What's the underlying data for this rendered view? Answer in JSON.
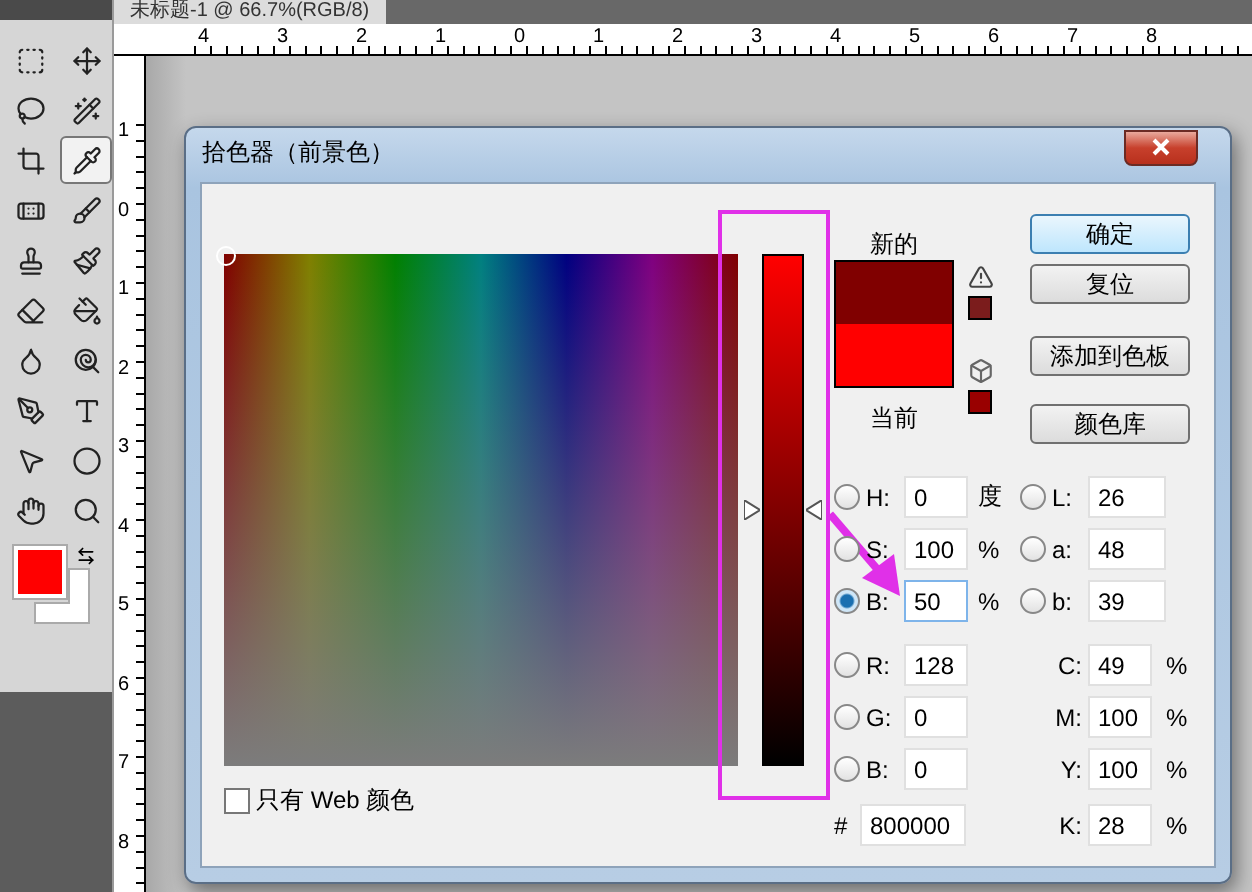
{
  "document_tab": {
    "title": "未标题-1 @ 66.7%(RGB/8)"
  },
  "tools": [
    {
      "selected": false
    },
    {
      "selected": false
    },
    {
      "selected": false
    },
    {
      "selected": false
    },
    {
      "selected": false
    },
    {
      "selected": true
    },
    {
      "selected": false
    },
    {
      "selected": false
    },
    {
      "selected": false
    },
    {
      "selected": false
    },
    {
      "selected": false
    },
    {
      "selected": false
    },
    {
      "selected": false
    },
    {
      "selected": false
    },
    {
      "selected": false
    },
    {
      "selected": false
    },
    {
      "selected": false
    },
    {
      "selected": false
    },
    {
      "selected": false
    },
    {
      "selected": false
    }
  ],
  "tool_colors": [
    {
      "kind": "foreground",
      "color": "#ff0000"
    },
    {
      "kind": "background",
      "color": "#ffffff"
    }
  ],
  "top_ruler": [
    "4",
    "3",
    "2",
    "1",
    "0",
    "1",
    "2",
    "3",
    "4",
    "5",
    "6",
    "7",
    "8"
  ],
  "left_ruler": [
    "1",
    "0",
    "1",
    "2",
    "3",
    "4",
    "5",
    "6",
    "7",
    "8"
  ],
  "dialog": {
    "title": "拾色器（前景色）",
    "slider": {
      "level": 0.5
    },
    "swatches": [
      {
        "label": "新的",
        "color": "#800000"
      },
      {
        "label": "当前",
        "color": "#ff0000"
      }
    ],
    "warnings": [
      {
        "kind": "gamut",
        "color": "#7b1c1c"
      },
      {
        "kind": "web",
        "color": "#990000"
      }
    ],
    "buttons": [
      {
        "label": "确定",
        "default": true
      },
      {
        "label": "复位",
        "default": false
      },
      {
        "label": "添加到色板",
        "default": false
      },
      {
        "label": "颜色库",
        "default": false
      }
    ],
    "left_fields": [
      {
        "label": "H:",
        "value": "0",
        "unit": "度",
        "selected": false
      },
      {
        "label": "S:",
        "value": "100",
        "unit": "%",
        "selected": false
      },
      {
        "label": "B:",
        "value": "50",
        "unit": "%",
        "selected": true
      },
      {
        "label": "R:",
        "value": "128",
        "selected": false
      },
      {
        "label": "G:",
        "value": "0",
        "selected": false
      },
      {
        "label": "B:",
        "value": "0",
        "selected": false
      }
    ],
    "hex": {
      "label": "#",
      "value": "800000"
    },
    "right_fields": [
      {
        "kind": "radio",
        "label": "L:",
        "value": "26",
        "selected": false
      },
      {
        "kind": "radio",
        "label": "a:",
        "value": "48",
        "selected": false
      },
      {
        "kind": "radio",
        "label": "b:",
        "value": "39",
        "selected": false
      },
      {
        "kind": "plain",
        "label": "C:",
        "value": "49",
        "unit": "%"
      },
      {
        "kind": "plain",
        "label": "M:",
        "value": "100",
        "unit": "%"
      },
      {
        "kind": "plain",
        "label": "Y:",
        "value": "100",
        "unit": "%"
      },
      {
        "kind": "plain",
        "label": "K:",
        "value": "28",
        "unit": "%"
      }
    ],
    "web_only": {
      "label": "只有 Web 颜色",
      "checked": false
    }
  },
  "annotations": {
    "slider_highlight": true,
    "arrow_to_field": true
  }
}
